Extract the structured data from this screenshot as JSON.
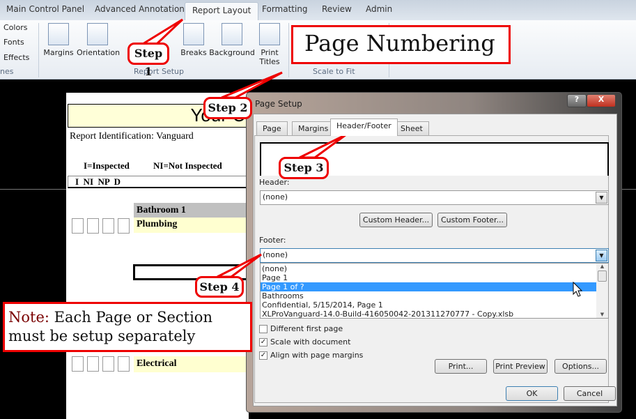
{
  "ribbon": {
    "tabs": [
      "Main Control Panel",
      "Advanced Annotation",
      "Report Layout",
      "Formatting",
      "Review",
      "Admin"
    ],
    "active_tab": "Report Layout",
    "themes": {
      "items": [
        "Colors",
        "Fonts",
        "Effects"
      ],
      "label": "nes"
    },
    "report_setup": {
      "buttons": [
        "Margins",
        "Orientation",
        "Breaks",
        "Background",
        "Print Titles"
      ],
      "label": "Report Setup"
    },
    "scale_to_fit": {
      "label": "Scale to Fit"
    }
  },
  "document": {
    "title_partial": "Your C",
    "report_id": "Report Identification: Vanguard",
    "legend_i": "I=Inspected",
    "legend_ni": "NI=Not Inspected",
    "columns": "I  NI  NP  D",
    "section": "Bathroom 1",
    "row1": "Plumbing",
    "row2": "Electrical"
  },
  "dialog": {
    "title": "Page Setup",
    "help": "?",
    "close": "X",
    "tabs": [
      "Page",
      "Margins",
      "Header/Footer",
      "Sheet"
    ],
    "active_tab": "Header/Footer",
    "header_label": "Header:",
    "header_value": "(none)",
    "custom_header": "Custom Header...",
    "custom_footer": "Custom Footer...",
    "footer_label": "Footer:",
    "footer_value": "(none)",
    "footer_options": [
      "(none)",
      "Page 1",
      "Page 1 of ?",
      "Bathrooms",
      " Confidential, 5/15/2014, Page 1",
      "XLProVanguard-14.0-Build-416050042-201311270777 - Copy.xlsb"
    ],
    "footer_selected": "Page 1 of ?",
    "checkboxes": [
      {
        "label": "Different first page",
        "checked": false
      },
      {
        "label": "Scale with document",
        "checked": true
      },
      {
        "label": "Align with page margins",
        "checked": true
      }
    ],
    "print": "Print...",
    "print_preview": "Print Preview",
    "options": "Options...",
    "ok": "OK",
    "cancel": "Cancel"
  },
  "annotations": {
    "heading": "Page Numbering",
    "step1": "Step 1",
    "step2": "Step 2",
    "step3": "Step 3",
    "step4": "Step 4",
    "note_label": "Note:",
    "note_text": " Each Page or Section must be setup separately",
    "accent": "#e00000"
  }
}
